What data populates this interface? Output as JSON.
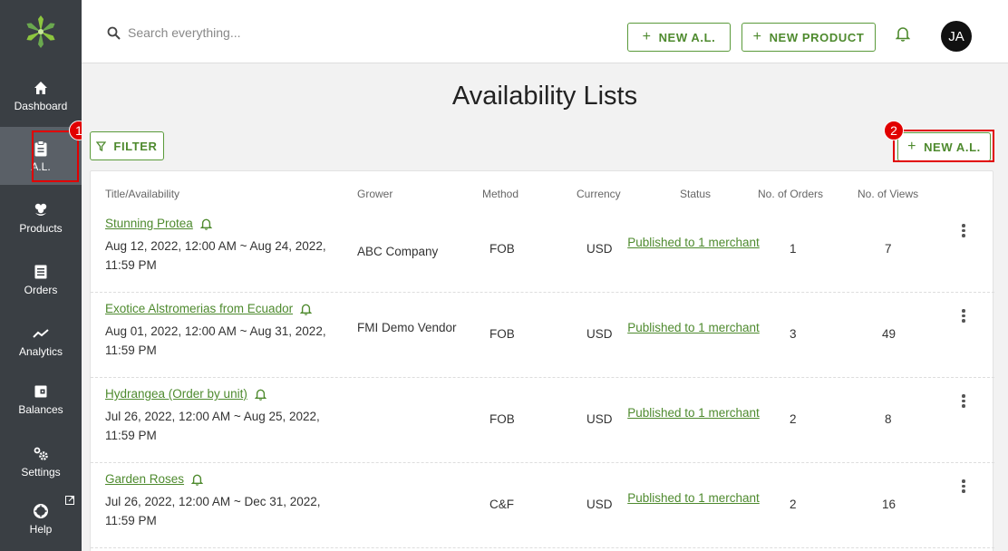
{
  "sidebar": {
    "items": [
      {
        "label": "Dashboard",
        "icon": "home-icon"
      },
      {
        "label": "A.L.",
        "icon": "clipboard-icon"
      },
      {
        "label": "Products",
        "icon": "flower-icon"
      },
      {
        "label": "Orders",
        "icon": "list-icon"
      },
      {
        "label": "Analytics",
        "icon": "trend-icon"
      },
      {
        "label": "Balances",
        "icon": "wallet-icon"
      },
      {
        "label": "Settings",
        "icon": "gears-icon"
      },
      {
        "label": "Help",
        "icon": "lifebuoy-icon"
      }
    ]
  },
  "annotations": {
    "badge1": "1",
    "badge2": "2"
  },
  "topbar": {
    "search_placeholder": "Search everything...",
    "new_al_label": "NEW A.L.",
    "new_product_label": "NEW PRODUCT",
    "avatar_initials": "JA"
  },
  "page": {
    "title": "Availability Lists",
    "filter_label": "FILTER",
    "new_al_label": "NEW A.L."
  },
  "table": {
    "headers": [
      "Title/Availability",
      "Grower",
      "Method",
      "Currency",
      "Status",
      "No. of Orders",
      "No. of Views"
    ],
    "rows": [
      {
        "title": "Stunning Protea",
        "dates": "Aug 12, 2022, 12:00 AM ~ Aug 24, 2022, 11:59 PM",
        "grower": "ABC Company",
        "method": "FOB",
        "currency": "USD",
        "status": "Published to 1 merchant",
        "orders": "1",
        "views": "7"
      },
      {
        "title": "Exotice Alstromerias from Ecuador",
        "dates": "Aug 01, 2022, 12:00 AM ~ Aug 31, 2022, 11:59 PM",
        "grower": "FMI Demo Vendor",
        "method": "FOB",
        "currency": "USD",
        "status": "Published to 1 merchant",
        "orders": "3",
        "views": "49"
      },
      {
        "title": "Hydrangea (Order by unit)",
        "dates": "Jul 26, 2022, 12:00 AM ~ Aug 25, 2022, 11:59 PM",
        "grower": "",
        "method": "FOB",
        "currency": "USD",
        "status": "Published to 1 merchant",
        "orders": "2",
        "views": "8"
      },
      {
        "title": "Garden Roses",
        "dates": "Jul 26, 2022, 12:00 AM ~ Dec 31, 2022, 11:59 PM",
        "grower": "",
        "method": "C&F",
        "currency": "USD",
        "status": "Published to 1 merchant",
        "orders": "2",
        "views": "16"
      }
    ]
  },
  "colors": {
    "accent": "#4e8a2e",
    "sidebar": "#3a3f44",
    "highlight": "#e10000"
  }
}
